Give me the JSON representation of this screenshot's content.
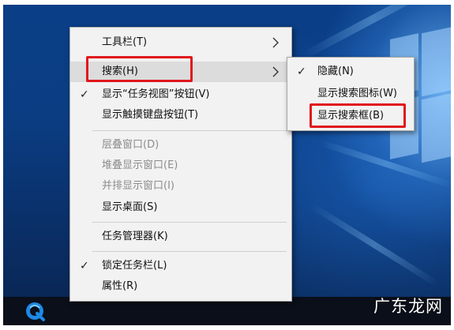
{
  "main_menu": {
    "items": [
      {
        "label": "工具栏(T)",
        "submenu": true,
        "checked": false,
        "disabled": false
      },
      {
        "label": "搜索(H)",
        "submenu": true,
        "checked": false,
        "disabled": false,
        "highlighted": true
      },
      {
        "label": "显示“任务视图”按钮(V)",
        "submenu": false,
        "checked": true,
        "disabled": false
      },
      {
        "label": "显示触摸键盘按钮(T)",
        "submenu": false,
        "checked": false,
        "disabled": false
      },
      {
        "label": "层叠窗口(D)",
        "submenu": false,
        "checked": false,
        "disabled": true
      },
      {
        "label": "堆叠显示窗口(E)",
        "submenu": false,
        "checked": false,
        "disabled": true
      },
      {
        "label": "并排显示窗口(I)",
        "submenu": false,
        "checked": false,
        "disabled": true
      },
      {
        "label": "显示桌面(S)",
        "submenu": false,
        "checked": false,
        "disabled": false
      },
      {
        "label": "任务管理器(K)",
        "submenu": false,
        "checked": false,
        "disabled": false
      },
      {
        "label": "锁定任务栏(L)",
        "submenu": false,
        "checked": true,
        "disabled": false
      },
      {
        "label": "属性(R)",
        "submenu": false,
        "checked": false,
        "disabled": false
      }
    ]
  },
  "search_submenu": {
    "items": [
      {
        "label": "隐藏(N)",
        "checked": true
      },
      {
        "label": "显示搜索图标(W)",
        "checked": false
      },
      {
        "label": "显示搜索框(B)",
        "checked": false,
        "highlighted": true
      }
    ]
  },
  "glyphs": {
    "check": "✓"
  },
  "watermark": "广东龙网",
  "colors": {
    "highlight_box": "#e0171c",
    "menu_bg": "#f2f2f2",
    "hover_bg": "#dcdcdc"
  }
}
